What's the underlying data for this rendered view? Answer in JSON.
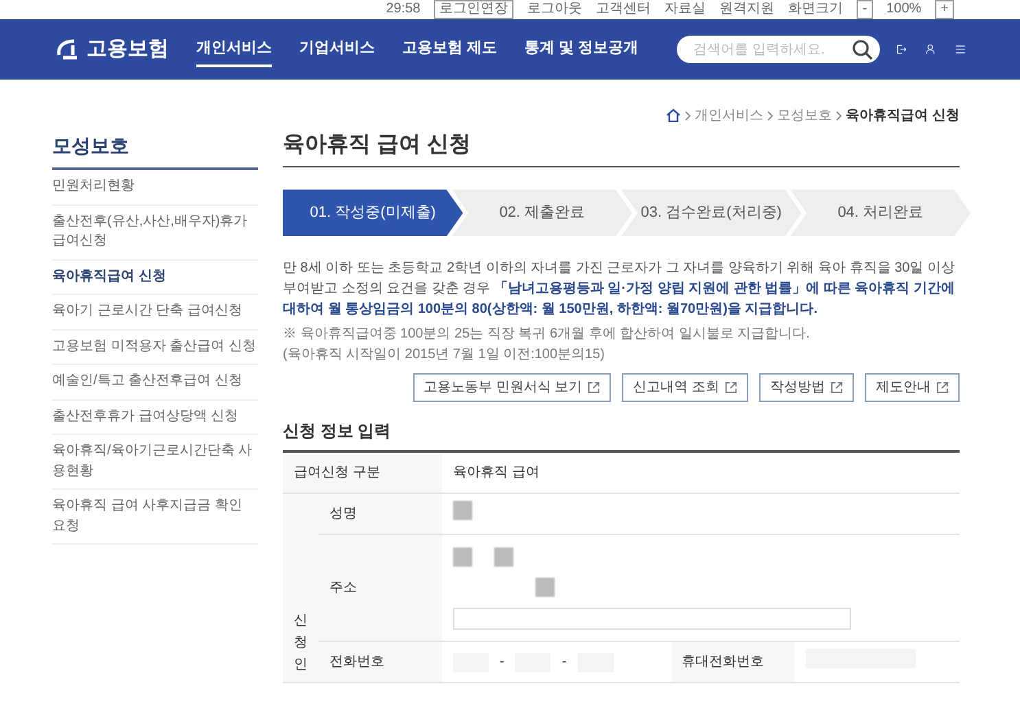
{
  "top_bar": {
    "timer": "29:58",
    "extend_button": "로그인연장",
    "links": [
      "로그아웃",
      "고객센터",
      "자료실",
      "원격지원",
      "화면크기"
    ],
    "zoom": {
      "minus": "-",
      "value": "100%",
      "plus": "+"
    }
  },
  "navbar": {
    "logo": "고용보험",
    "menu": [
      {
        "label": "개인서비스",
        "selected": true
      },
      {
        "label": "기업서비스",
        "selected": false
      },
      {
        "label": "고용보험 제도",
        "selected": false
      },
      {
        "label": "통계 및 정보공개",
        "selected": false
      }
    ],
    "search": {
      "placeholder": "검색어를 입력하세요."
    }
  },
  "breadcrumb": [
    "개인서비스",
    "모성보호",
    "육아휴직급여 신청"
  ],
  "sidebar": {
    "title": "모성보호",
    "items": [
      {
        "label": "민원처리현황",
        "selected": false
      },
      {
        "label": "출산전후(유산,사산,배우자)휴가 급여신청",
        "selected": false
      },
      {
        "label": "육아휴직급여 신청",
        "selected": true
      },
      {
        "label": "육아기 근로시간 단축 급여신청",
        "selected": false
      },
      {
        "label": "고용보험 미적용자 출산급여 신청",
        "selected": false
      },
      {
        "label": "예술인/특고 출산전후급여 신청",
        "selected": false
      },
      {
        "label": "출산전후휴가 급여상당액 신청",
        "selected": false
      },
      {
        "label": "육아휴직/육아기근로시간단축 사용현황",
        "selected": false
      },
      {
        "label": "육아휴직 급여 사후지급금 확인 요청",
        "selected": false
      }
    ]
  },
  "page_title": "육아휴직 급여 신청",
  "steps": [
    {
      "label": "01. 작성중(미제출)",
      "selected": true
    },
    {
      "label": "02. 제출완료",
      "selected": false
    },
    {
      "label": "03. 검수완료(처리중)",
      "selected": false
    },
    {
      "label": "04. 처리완료",
      "selected": false
    }
  ],
  "intro": {
    "text": "만 8세 이하 또는 초등학교 2학년 이하의 자녀를 가진 근로자가 그 자녀를 양육하기 위해 육아 휴직을 30일 이상 부여받고 소정의 요건을 갖춘 경우 **「남녀고용평등과 일·가정 양립 지원에 관한 법률」에 따른 육아휴직 기간에 대하여 월 통상임금의 100분의 80(상한액: 월 150만원, 하한액: 월70만원)을 지급합니다.**",
    "notes": [
      "※ 육아휴직급여중 100분의 25는 직장 복귀 6개월 후에 합산하여 일시불로 지급합니다.",
      "(육아휴직 시작일이 2015년 7월 1일 이전:100분의15)"
    ]
  },
  "link_buttons": [
    "고용노동부 민원서식 보기",
    "신고내역 조회",
    "작성방법",
    "제도안내"
  ],
  "section_title": "신청 정보 입력",
  "form": {
    "benefit_type": {
      "label": "급여신청 구분",
      "value": "육아휴직 급여"
    },
    "applicant": {
      "label": "신청인",
      "fields": [
        {
          "kind": "name",
          "label": "성명"
        },
        {
          "kind": "address",
          "label": "주소"
        },
        {
          "kind": "phone",
          "label": "전화번호",
          "separator": "-",
          "extra_label": "휴대전화번호"
        }
      ]
    }
  }
}
